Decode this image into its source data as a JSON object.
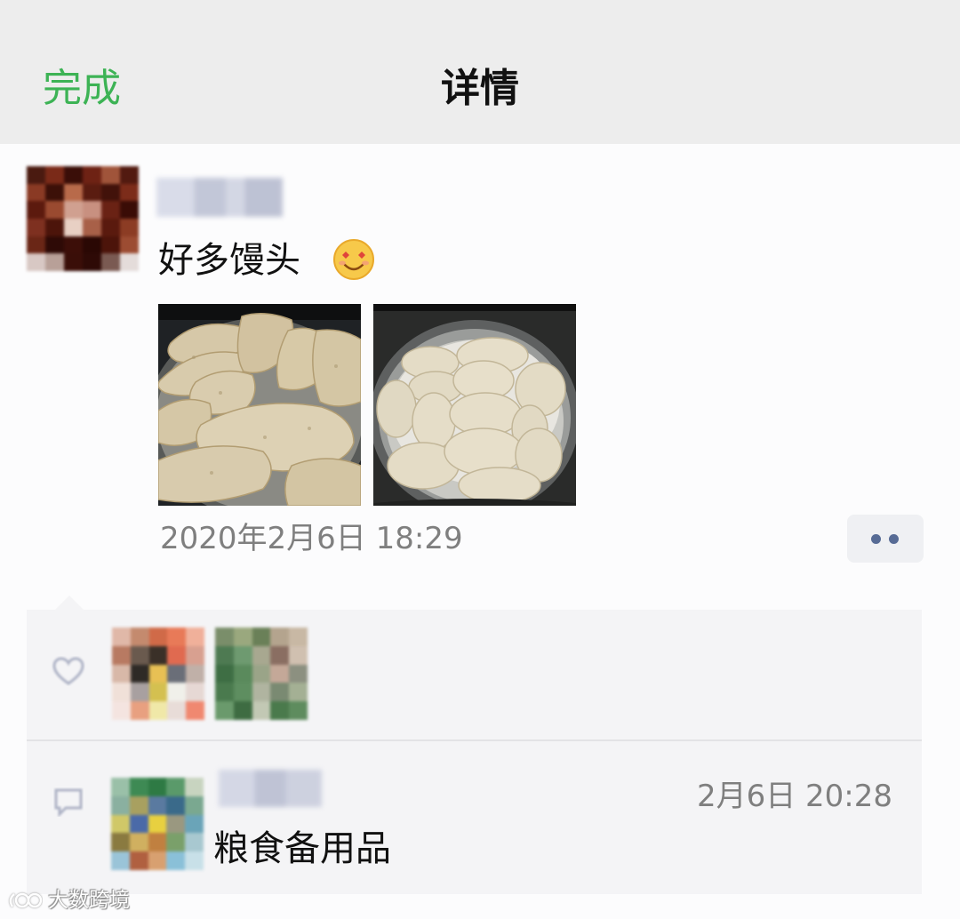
{
  "nav": {
    "done": "完成",
    "title": "详情"
  },
  "post": {
    "text": "好多馒头",
    "time": "2020年2月6日 18:29"
  },
  "comments": [
    {
      "time": "2月6日 20:28",
      "text": "粮食备用品"
    }
  ],
  "watermark": "大数跨境",
  "colors": {
    "accent_green": "#3db355",
    "link_blue": "#576b95",
    "nav_bg": "#ededed",
    "meta_gray": "#7f7f7f"
  },
  "icons": [
    "smiling-face-with-heart-eyes-emoji",
    "more-dots-icon",
    "heart-icon",
    "comment-icon"
  ]
}
